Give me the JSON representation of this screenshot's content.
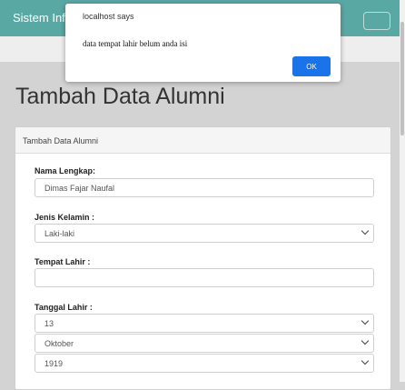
{
  "navbar": {
    "brand": "Sistem Informasi Alumni"
  },
  "page": {
    "title": "Tambah Data Alumni"
  },
  "card": {
    "header": "Tambah Data Alumni",
    "fields": {
      "nama": {
        "label": "Nama Lengkap:",
        "value": "Dimas Fajar Naufal"
      },
      "jenis_kelamin": {
        "label": "Jenis Kelamin :",
        "value": "Laki-laki"
      },
      "tempat_lahir": {
        "label": "Tempat Lahir :",
        "value": ""
      },
      "tanggal_lahir": {
        "label": "Tanggal Lahir :",
        "day": "13",
        "month": "Oktober",
        "year": "1919"
      }
    }
  },
  "dialog": {
    "title": "localhost says",
    "message": "data tempat lahir belum anda isi",
    "ok_label": "OK"
  },
  "colors": {
    "navbar": "#5aa8a4",
    "ok_button": "#1a73e8",
    "backdrop": "#d3d3d3"
  }
}
